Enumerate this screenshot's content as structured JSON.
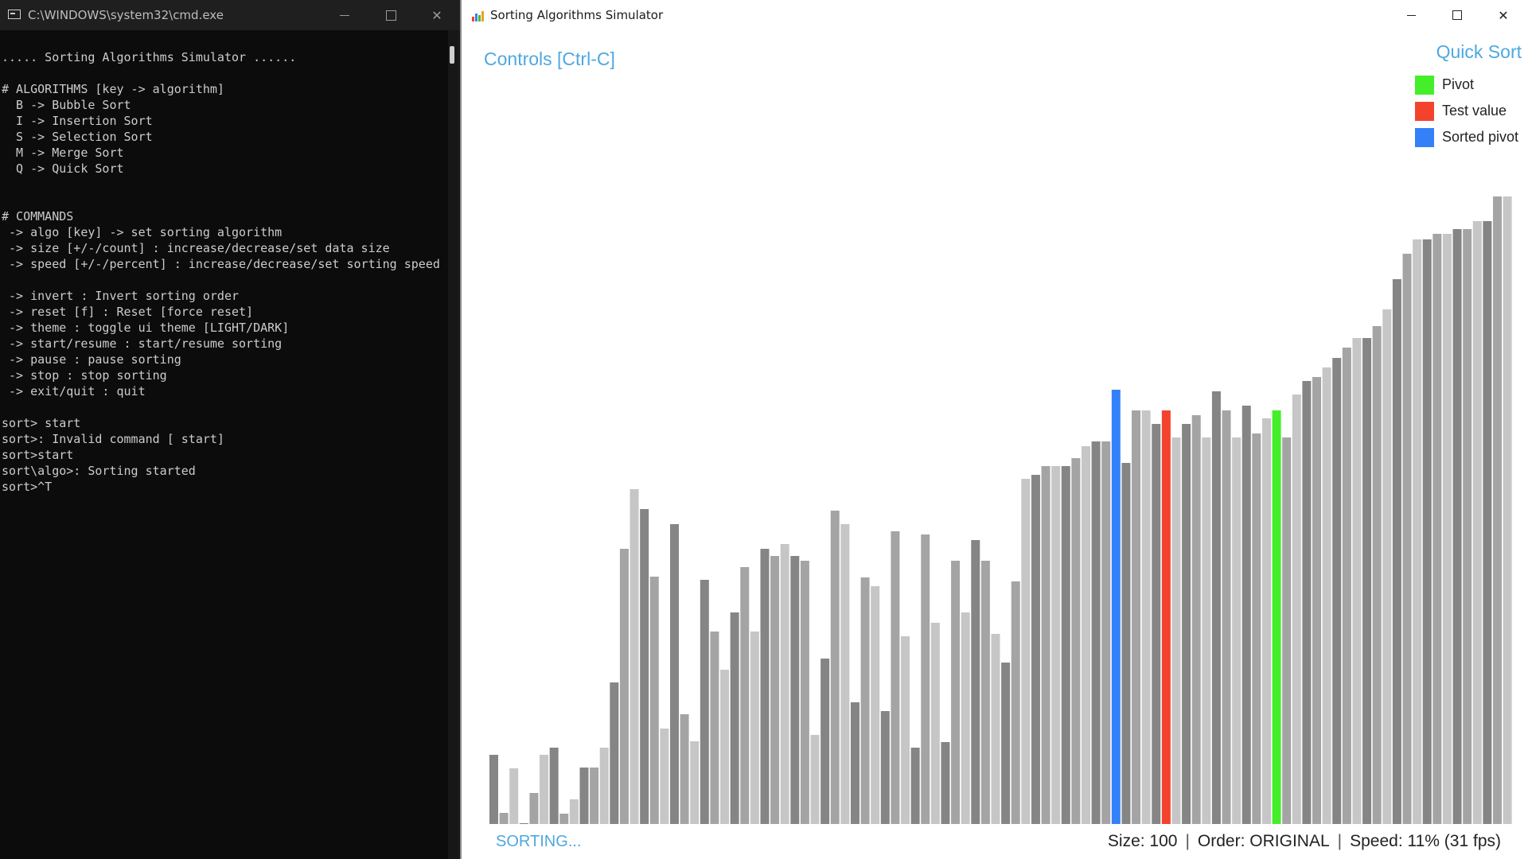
{
  "console": {
    "title": "C:\\WINDOWS\\system32\\cmd.exe",
    "lines": [
      "..... Sorting Algorithms Simulator ......",
      "",
      "# ALGORITHMS [key -> algorithm]",
      "  B -> Bubble Sort",
      "  I -> Insertion Sort",
      "  S -> Selection Sort",
      "  M -> Merge Sort",
      "  Q -> Quick Sort",
      "",
      "",
      "# COMMANDS",
      " -> algo [key] -> set sorting algorithm",
      " -> size [+/-/count] : increase/decrease/set data size",
      " -> speed [+/-/percent] : increase/decrease/set sorting speed",
      "",
      " -> invert : Invert sorting order",
      " -> reset [f] : Reset [force reset]",
      " -> theme : toggle ui theme [LIGHT/DARK]",
      " -> start/resume : start/resume sorting",
      " -> pause : pause sorting",
      " -> stop : stop sorting",
      " -> exit/quit : quit",
      "",
      "sort> start",
      "sort>: Invalid command [ start]",
      "sort>start",
      "sort\\algo>: Sorting started",
      "sort>^T"
    ]
  },
  "simulator": {
    "title": "Sorting Algorithms Simulator",
    "controls_label": "Controls [Ctrl-C]",
    "algorithm": "Quick Sort",
    "legend": [
      {
        "label": "Pivot",
        "color": "#44ef2a"
      },
      {
        "label": "Test value",
        "color": "#f4432d"
      },
      {
        "label": "Sorted pivot",
        "color": "#3480f8"
      }
    ],
    "status": "SORTING...",
    "size_text": "Size: 100",
    "order_text": "Order: ORIGINAL",
    "speed_text": "Speed: 11% (31 fps)",
    "separator": "|"
  },
  "chart_data": {
    "type": "bar",
    "count": 100,
    "values": [
      87,
      14,
      70,
      1,
      39,
      87,
      96,
      13,
      31,
      71,
      71,
      96,
      178,
      346,
      421,
      396,
      311,
      120,
      377,
      138,
      104,
      307,
      242,
      194,
      266,
      323,
      242,
      346,
      337,
      352,
      337,
      331,
      112,
      208,
      394,
      377,
      153,
      310,
      299,
      142,
      368,
      236,
      96,
      364,
      253,
      103,
      331,
      266,
      357,
      331,
      239,
      203,
      305,
      434,
      439,
      450,
      450,
      450,
      460,
      475,
      481,
      481,
      546,
      454,
      520,
      520,
      503,
      520,
      486,
      503,
      514,
      486,
      544,
      520,
      486,
      526,
      491,
      510,
      520,
      486,
      540,
      557,
      562,
      574,
      586,
      599,
      611,
      611,
      626,
      647,
      685,
      717,
      735,
      735,
      742,
      742,
      748,
      748,
      758,
      758,
      789,
      789
    ],
    "colors_by_index": {
      "62": "#3480f8",
      "67": "#f4432d",
      "78": "#44ef2a"
    },
    "shade_cycle": [
      "#858585",
      "#a4a4a4",
      "#c6c6c6"
    ]
  }
}
